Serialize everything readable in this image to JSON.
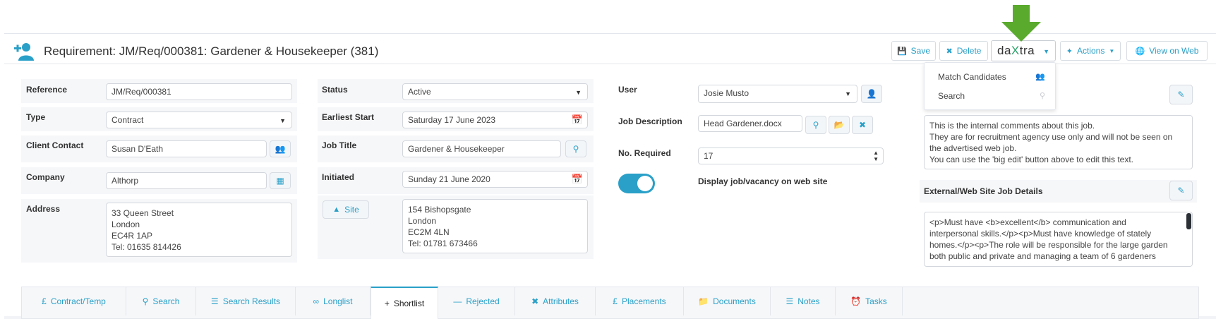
{
  "header": {
    "title": "Requirement: JM/Req/000381: Gardener & Housekeeper (381)",
    "title_icon": "user-add-icon",
    "accent_color": "#2aa0c8",
    "buttons": {
      "save": "Save",
      "delete": "Delete",
      "actions": "Actions",
      "view_on_web": "View on Web"
    },
    "daxtra": {
      "logo_prefix": "da",
      "logo_x": "X",
      "logo_suffix": "tra"
    }
  },
  "daxtra_menu": [
    {
      "label": "Match Candidates",
      "icon": "users-icon"
    },
    {
      "label": "Search",
      "icon": "search-icon"
    }
  ],
  "col1": {
    "reference_label": "Reference",
    "reference_value": "JM/Req/000381",
    "type_label": "Type",
    "type_value": "Contract",
    "client_contact_label": "Client Contact",
    "client_contact_value": "Susan D'Eath",
    "company_label": "Company",
    "company_value": "Althorp",
    "address_label": "Address",
    "address_lines": [
      "33 Queen Street",
      "London",
      "EC4R 1AP",
      "Tel: 01635 814426"
    ]
  },
  "col2": {
    "status_label": "Status",
    "status_value": "Active",
    "earliest_start_label": "Earliest Start",
    "earliest_start_value": "Saturday 17 June 2023",
    "job_title_label": "Job Title",
    "job_title_value": "Gardener & Housekeeper",
    "initiated_label": "Initiated",
    "initiated_value": "Sunday 21 June 2020",
    "site_button": "Site",
    "site_lines": [
      "154 Bishopsgate",
      "London",
      "EC2M 4LN",
      "Tel: 01781 673466"
    ]
  },
  "col3": {
    "user_label": "User",
    "user_value": "Josie Musto",
    "job_description_label": "Job Description",
    "job_description_value": "Head Gardener.docx",
    "no_required_label": "No. Required",
    "no_required_value": "17",
    "display_web_label": "Display job/vacancy on web site"
  },
  "comments": {
    "lines": [
      "This is the internal comments about this job.",
      "They are for recruitment agency use only and will not be seen on",
      "the advertised web job.",
      "You can use the 'big edit' button above to edit this text."
    ]
  },
  "web_details": {
    "title": "External/Web Site Job Details",
    "lines": [
      "<p>Must have <b>excellent</b> communication and",
      "interpersonal skills.</p><p>Must have knowledge of stately",
      "homes.</p><p>The role will be responsible for the large garden",
      "both public and private and managing a team of 6 gardeners"
    ]
  },
  "tabs": [
    {
      "label": "Contract/Temp",
      "icon": "pound-icon"
    },
    {
      "label": "Search",
      "icon": "search-icon"
    },
    {
      "label": "Search Results",
      "icon": "database-icon"
    },
    {
      "label": "Longlist",
      "icon": "link-icon"
    },
    {
      "label": "Shortlist",
      "icon": "plus-icon"
    },
    {
      "label": "Rejected",
      "icon": "minus-icon"
    },
    {
      "label": "Attributes",
      "icon": "tools-icon"
    },
    {
      "label": "Placements",
      "icon": "pound-icon"
    },
    {
      "label": "Documents",
      "icon": "folder-icon"
    },
    {
      "label": "Notes",
      "icon": "notes-icon"
    },
    {
      "label": "Tasks",
      "icon": "alarm-icon"
    }
  ]
}
